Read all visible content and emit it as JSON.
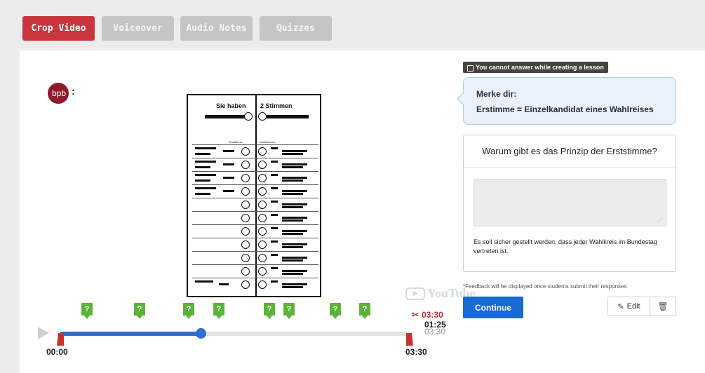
{
  "tabs": [
    {
      "label": "Crop Video",
      "active": true
    },
    {
      "label": "Voiceover",
      "active": false
    },
    {
      "label": "Audio Notes",
      "active": false
    },
    {
      "label": "Quizzes",
      "active": false
    }
  ],
  "video": {
    "logo_text": "bpb",
    "logo_colon": ":",
    "ballot_header_left": "Sie haben",
    "ballot_header_right": "2 Stimmen",
    "ballot_sub_left": "Erststimme",
    "ballot_sub_right": "Zweitstimme",
    "watermark": "YouTube"
  },
  "timeline": {
    "start_time": "00:00",
    "end_time": "03:30",
    "crop_time": "03:30",
    "current_time": "01:25",
    "duration": "03:30",
    "progress_fraction": 0.405,
    "quiz_marker_label": "?",
    "quiz_marker_count": 8
  },
  "notice": {
    "locked_text": "You cannot answer while creating a lesson"
  },
  "message": {
    "line1": "Merke dir:",
    "line2": "Erstimme = Einzelkandidat eines Wahlreises"
  },
  "question": {
    "title": "Warum gibt es das Prinzip der Erststimme?",
    "answer_value": "",
    "feedback": "Es soll sicher gestellt werden, dass jeder Wahlkreis im Bundestag vertreten ist."
  },
  "footer": {
    "note": "*Feedback will be displayed once students submit their responses",
    "continue_label": "Continue",
    "edit_label": "Edit"
  },
  "colors": {
    "accent": "#c9363d",
    "primary": "#1769d4",
    "marker": "#5bb33a"
  }
}
